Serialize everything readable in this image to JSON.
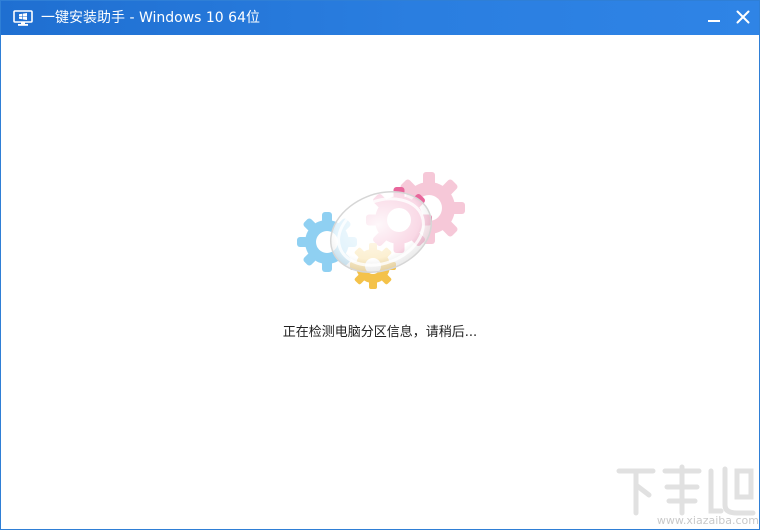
{
  "window": {
    "title": "一键安装助手 - Windows 10 64位",
    "accent_color": "#2a7ee0"
  },
  "titlebar": {
    "app_icon": "monitor-windows-icon",
    "minimize_icon": "minimize-icon",
    "close_icon": "close-icon"
  },
  "main": {
    "loader_icon": "gears-loading-icon",
    "status_message": "正在检测电脑分区信息，请稍后..."
  },
  "watermark": {
    "logo_text": "下载吧",
    "url": "www.xiazaiba.com"
  }
}
